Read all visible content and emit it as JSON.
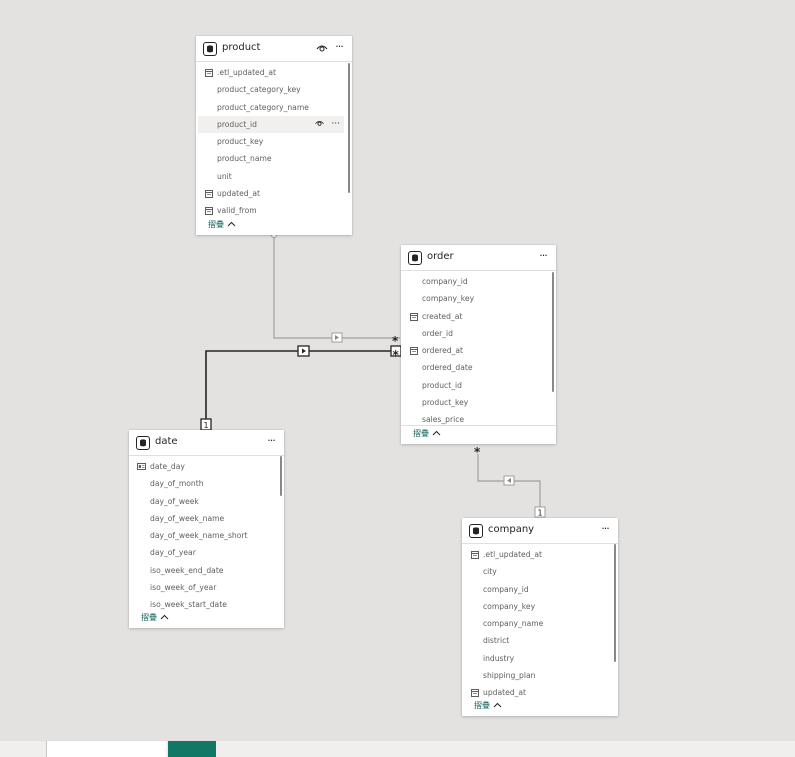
{
  "tables": {
    "product": {
      "name": "product",
      "fields": [
        ".etl_updated_at",
        "product_category_key",
        "product_category_name",
        "product_id",
        "product_key",
        "product_name",
        "unit",
        "updated_at",
        "valid_from"
      ],
      "collapse_label": "摺疊"
    },
    "order": {
      "name": "order",
      "fields": [
        "company_id",
        "company_key",
        "created_at",
        "order_id",
        "ordered_at",
        "ordered_date",
        "product_id",
        "product_key",
        "sales_price"
      ],
      "collapse_label": "摺疊"
    },
    "date": {
      "name": "date",
      "fields": [
        "date_day",
        "day_of_month",
        "day_of_week",
        "day_of_week_name",
        "day_of_week_name_short",
        "day_of_year",
        "iso_week_end_date",
        "iso_week_of_year",
        "iso_week_start_date"
      ],
      "collapse_label": "摺疊"
    },
    "company": {
      "name": "company",
      "fields": [
        ".etl_updated_at",
        "city",
        "company_id",
        "company_key",
        "company_name",
        "district",
        "industry",
        "shipping_plan",
        "updated_at"
      ],
      "collapse_label": "摺疊"
    }
  },
  "relationships": [
    {
      "from": "product",
      "to": "order",
      "from_card": "1",
      "to_card": "*",
      "active": false
    },
    {
      "from": "date",
      "to": "order",
      "from_card": "1",
      "to_card": "*",
      "active": true
    },
    {
      "from": "company",
      "to": "order",
      "from_card": "1",
      "to_card": "*",
      "active": false
    }
  ],
  "more_label": "···",
  "colors": {
    "canvas": "#e3e2e1",
    "accent": "#117865",
    "collapse_text": "#0e5f58"
  }
}
